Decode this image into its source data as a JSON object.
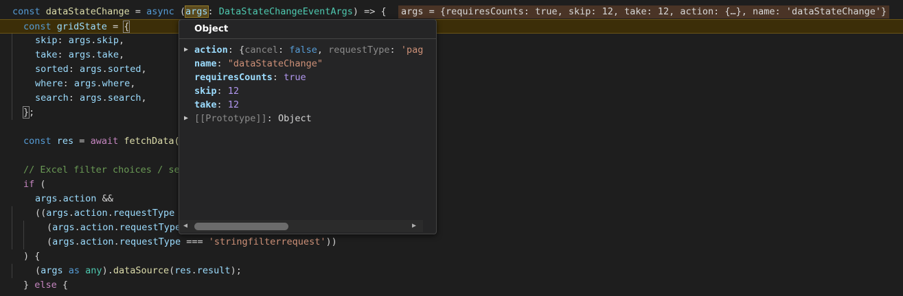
{
  "lines": [
    {
      "id": "l1",
      "segments": [
        [
          "kw",
          "const "
        ],
        [
          "fn",
          "dataStateChange"
        ],
        [
          "punc",
          " = "
        ],
        [
          "kw",
          "async "
        ],
        [
          "punc",
          "("
        ],
        [
          "var hlword",
          "args"
        ],
        [
          "punc",
          ": "
        ],
        [
          "type",
          "DataStateChangeEventArgs"
        ],
        [
          "punc",
          ") => {"
        ]
      ]
    },
    {
      "id": "l2",
      "segments": [
        [
          "kw",
          "const "
        ],
        [
          "var",
          "gridState"
        ],
        [
          "punc",
          " = "
        ],
        [
          "punc bracket-match",
          "{"
        ]
      ]
    },
    {
      "id": "l3",
      "segments": [
        [
          "var",
          "skip"
        ],
        [
          "punc",
          ": "
        ],
        [
          "var",
          "args"
        ],
        [
          "punc",
          "."
        ],
        [
          "var",
          "skip"
        ],
        [
          "punc",
          ","
        ]
      ]
    },
    {
      "id": "l4",
      "segments": [
        [
          "var",
          "take"
        ],
        [
          "punc",
          ": "
        ],
        [
          "var",
          "args"
        ],
        [
          "punc",
          "."
        ],
        [
          "var",
          "take"
        ],
        [
          "punc",
          ","
        ]
      ]
    },
    {
      "id": "l5",
      "segments": [
        [
          "var",
          "sorted"
        ],
        [
          "punc",
          ": "
        ],
        [
          "var",
          "args"
        ],
        [
          "punc",
          "."
        ],
        [
          "var",
          "sorted"
        ],
        [
          "punc",
          ","
        ]
      ]
    },
    {
      "id": "l6",
      "segments": [
        [
          "var",
          "where"
        ],
        [
          "punc",
          ": "
        ],
        [
          "var",
          "args"
        ],
        [
          "punc",
          "."
        ],
        [
          "var",
          "where"
        ],
        [
          "punc",
          ","
        ]
      ]
    },
    {
      "id": "l7",
      "segments": [
        [
          "var",
          "search"
        ],
        [
          "punc",
          ": "
        ],
        [
          "var",
          "args"
        ],
        [
          "punc",
          "."
        ],
        [
          "var",
          "search"
        ],
        [
          "punc",
          ","
        ]
      ]
    },
    {
      "id": "l8",
      "segments": [
        [
          "punc bracket-match",
          "}"
        ],
        [
          "punc",
          ";"
        ]
      ]
    },
    {
      "id": "l9",
      "segments": []
    },
    {
      "id": "l10",
      "segments": [
        [
          "kw",
          "const "
        ],
        [
          "var",
          "res"
        ],
        [
          "punc",
          " = "
        ],
        [
          "kw2",
          "await "
        ],
        [
          "fn",
          "fetchData("
        ]
      ]
    },
    {
      "id": "l11",
      "segments": []
    },
    {
      "id": "l12",
      "segments": [
        [
          "cmt",
          "// Excel filter choices / se"
        ]
      ]
    },
    {
      "id": "l13",
      "segments": [
        [
          "kw2",
          "if "
        ],
        [
          "punc",
          "("
        ]
      ]
    },
    {
      "id": "l14",
      "segments": [
        [
          "var",
          "args"
        ],
        [
          "punc",
          "."
        ],
        [
          "var",
          "action"
        ],
        [
          "punc",
          " &&"
        ]
      ]
    },
    {
      "id": "l15",
      "segments": [
        [
          "punc",
          "(("
        ],
        [
          "var",
          "args"
        ],
        [
          "punc",
          "."
        ],
        [
          "var",
          "action"
        ],
        [
          "punc",
          "."
        ],
        [
          "var",
          "requestType"
        ]
      ]
    },
    {
      "id": "l16",
      "segments": [
        [
          "punc",
          "("
        ],
        [
          "var",
          "args"
        ],
        [
          "punc",
          "."
        ],
        [
          "var",
          "action"
        ],
        [
          "punc",
          "."
        ],
        [
          "var",
          "requestType"
        ]
      ]
    },
    {
      "id": "l17",
      "segments": [
        [
          "punc",
          "("
        ],
        [
          "var",
          "args"
        ],
        [
          "punc",
          "."
        ],
        [
          "var",
          "action"
        ],
        [
          "punc",
          "."
        ],
        [
          "var",
          "requestType"
        ],
        [
          "punc",
          " === "
        ],
        [
          "str",
          "'stringfilterrequest'"
        ],
        [
          "punc",
          "))"
        ]
      ]
    },
    {
      "id": "l18",
      "segments": [
        [
          "punc",
          ") {"
        ]
      ]
    },
    {
      "id": "l19",
      "segments": [
        [
          "punc",
          "("
        ],
        [
          "var",
          "args"
        ],
        [
          "kw",
          " as "
        ],
        [
          "type",
          "any"
        ],
        [
          "punc",
          ")."
        ],
        [
          "fn",
          "dataSource"
        ],
        [
          "punc",
          "("
        ],
        [
          "var",
          "res"
        ],
        [
          "punc",
          "."
        ],
        [
          "var",
          "result"
        ],
        [
          "punc",
          ");"
        ]
      ]
    },
    {
      "id": "l20",
      "segments": [
        [
          "punc",
          "} "
        ],
        [
          "kw2",
          "else "
        ],
        [
          "punc",
          "{"
        ]
      ]
    }
  ],
  "inline_value": "args = {requiresCounts: true, skip: 12, take: 12, action: {…}, name: 'dataStateChange'}",
  "hover": {
    "title": "Object",
    "rows": [
      {
        "expandable": true,
        "key": "action",
        "rest": "{cancel: false, requestType: 'pag"
      },
      {
        "expandable": false,
        "key": "name",
        "value": "\"dataStateChange\"",
        "kind": "str"
      },
      {
        "expandable": false,
        "key": "requiresCounts",
        "value": "true",
        "kind": "bool"
      },
      {
        "expandable": false,
        "key": "skip",
        "value": "12",
        "kind": "num"
      },
      {
        "expandable": false,
        "key": "take",
        "value": "12",
        "kind": "num"
      },
      {
        "expandable": true,
        "key": "[[Prototype]]",
        "value": "Object",
        "kind": "proto"
      }
    ],
    "scroll_left": "◀",
    "scroll_right": "▶"
  },
  "icons": {
    "expand": "▶"
  },
  "colors": {
    "current_line": "#3c2e08",
    "hover_bg": "#252526"
  }
}
